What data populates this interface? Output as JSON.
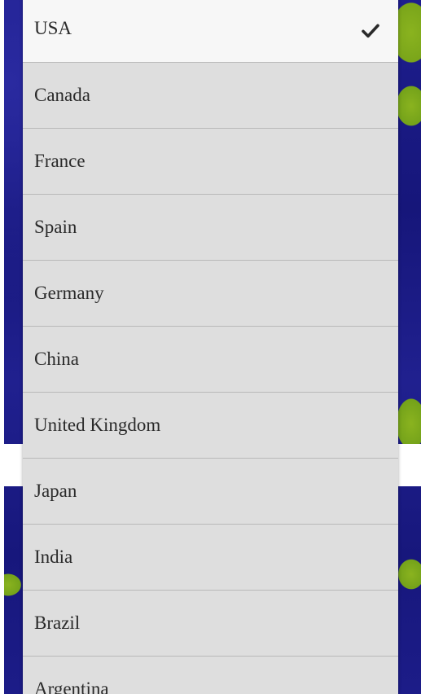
{
  "dropdown": {
    "selected_index": 0,
    "items": [
      {
        "label": "USA",
        "selected": true
      },
      {
        "label": "Canada",
        "selected": false
      },
      {
        "label": "France",
        "selected": false
      },
      {
        "label": "Spain",
        "selected": false
      },
      {
        "label": "Germany",
        "selected": false
      },
      {
        "label": "China",
        "selected": false
      },
      {
        "label": "United Kingdom",
        "selected": false
      },
      {
        "label": "Japan",
        "selected": false
      },
      {
        "label": "India",
        "selected": false
      },
      {
        "label": "Brazil",
        "selected": false
      },
      {
        "label": "Argentina",
        "selected": false
      }
    ]
  },
  "icons": {
    "selected_marker": "checkmark-icon"
  },
  "colors": {
    "list_background": "#dedede",
    "selected_background": "#f7f7f7",
    "text": "#2a2a2a",
    "page_background": "#1c1c86",
    "land_green": "#8ab31f"
  }
}
